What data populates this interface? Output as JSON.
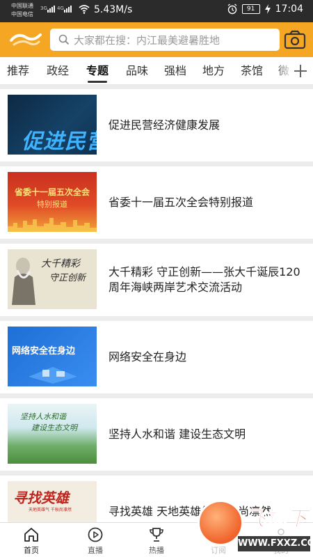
{
  "status_bar": {
    "carrier1": "中国联通",
    "carrier2": "中国电信",
    "net1": "3G",
    "net2": "4G",
    "speed": "5.43M/s",
    "battery": "91",
    "time": "17:04",
    "icons": [
      "signal-icon",
      "wifi-icon",
      "alarm-icon",
      "battery-icon",
      "charging-icon"
    ]
  },
  "header": {
    "search_placeholder": "大家都在搜：内江最美避暑胜地",
    "accent": "#f5a623",
    "icons": [
      "logo-icon",
      "search-icon",
      "camera-icon"
    ]
  },
  "tabs": {
    "items": [
      "推荐",
      "政经",
      "专题",
      "品味",
      "强档",
      "地方",
      "茶馆",
      "微"
    ],
    "active_index": 2,
    "add_icon": "plus-icon"
  },
  "feed": [
    {
      "title": "促进民营经济健康发展",
      "thumb_text": "促进民营"
    },
    {
      "title": "省委十一届五次全会特别报道",
      "thumb_text_1": "省委十一届五次全会",
      "thumb_text_2": "特别报道"
    },
    {
      "title": "大千精彩 守正创新——张大千诞辰120周年海峡两岸艺术交流活动",
      "thumb_text_1": "大千精彩",
      "thumb_text_2": "守正创新"
    },
    {
      "title": "网络安全在身边",
      "thumb_text": "网络安全在身边"
    },
    {
      "title": "坚持人水和谐 建设生态文明",
      "thumb_text_1": "坚持人水和谐",
      "thumb_text_2": "建设生态文明"
    },
    {
      "title": "寻找英雄 天地英雄气 千秋尚凛然",
      "thumb_text": "寻找英雄",
      "thumb_sub": "天地英雄气 千秋尚凛然"
    }
  ],
  "bottom_nav": {
    "items": [
      {
        "label": "首页",
        "icon": "home-icon"
      },
      {
        "label": "直播",
        "icon": "play-icon"
      },
      {
        "label": "热播",
        "icon": "trophy-icon"
      },
      {
        "label": "订阅",
        "icon": "subscribe-icon"
      },
      {
        "label": "我的",
        "icon": "user-icon"
      }
    ],
    "active_index": 0
  },
  "watermark": {
    "name": "飞翔下载",
    "url": "WWW.FXXZ.COM"
  }
}
